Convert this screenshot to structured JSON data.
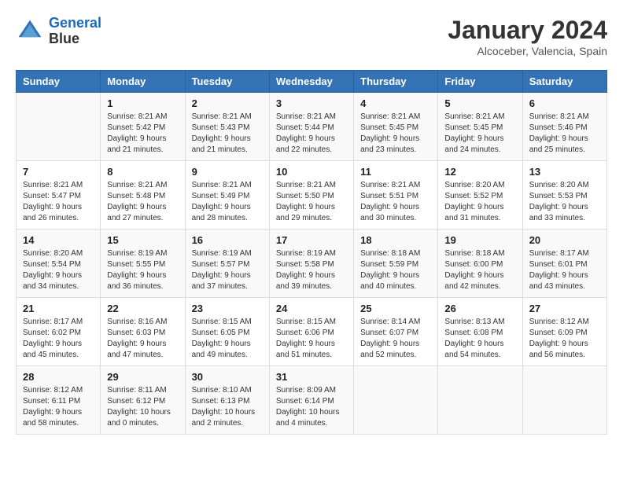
{
  "header": {
    "logo_line1": "General",
    "logo_line2": "Blue",
    "title": "January 2024",
    "subtitle": "Alcoceber, Valencia, Spain"
  },
  "days_of_week": [
    "Sunday",
    "Monday",
    "Tuesday",
    "Wednesday",
    "Thursday",
    "Friday",
    "Saturday"
  ],
  "weeks": [
    [
      {
        "day": "",
        "info": ""
      },
      {
        "day": "1",
        "info": "Sunrise: 8:21 AM\nSunset: 5:42 PM\nDaylight: 9 hours\nand 21 minutes."
      },
      {
        "day": "2",
        "info": "Sunrise: 8:21 AM\nSunset: 5:43 PM\nDaylight: 9 hours\nand 21 minutes."
      },
      {
        "day": "3",
        "info": "Sunrise: 8:21 AM\nSunset: 5:44 PM\nDaylight: 9 hours\nand 22 minutes."
      },
      {
        "day": "4",
        "info": "Sunrise: 8:21 AM\nSunset: 5:45 PM\nDaylight: 9 hours\nand 23 minutes."
      },
      {
        "day": "5",
        "info": "Sunrise: 8:21 AM\nSunset: 5:45 PM\nDaylight: 9 hours\nand 24 minutes."
      },
      {
        "day": "6",
        "info": "Sunrise: 8:21 AM\nSunset: 5:46 PM\nDaylight: 9 hours\nand 25 minutes."
      }
    ],
    [
      {
        "day": "7",
        "info": "Sunrise: 8:21 AM\nSunset: 5:47 PM\nDaylight: 9 hours\nand 26 minutes."
      },
      {
        "day": "8",
        "info": "Sunrise: 8:21 AM\nSunset: 5:48 PM\nDaylight: 9 hours\nand 27 minutes."
      },
      {
        "day": "9",
        "info": "Sunrise: 8:21 AM\nSunset: 5:49 PM\nDaylight: 9 hours\nand 28 minutes."
      },
      {
        "day": "10",
        "info": "Sunrise: 8:21 AM\nSunset: 5:50 PM\nDaylight: 9 hours\nand 29 minutes."
      },
      {
        "day": "11",
        "info": "Sunrise: 8:21 AM\nSunset: 5:51 PM\nDaylight: 9 hours\nand 30 minutes."
      },
      {
        "day": "12",
        "info": "Sunrise: 8:20 AM\nSunset: 5:52 PM\nDaylight: 9 hours\nand 31 minutes."
      },
      {
        "day": "13",
        "info": "Sunrise: 8:20 AM\nSunset: 5:53 PM\nDaylight: 9 hours\nand 33 minutes."
      }
    ],
    [
      {
        "day": "14",
        "info": "Sunrise: 8:20 AM\nSunset: 5:54 PM\nDaylight: 9 hours\nand 34 minutes."
      },
      {
        "day": "15",
        "info": "Sunrise: 8:19 AM\nSunset: 5:55 PM\nDaylight: 9 hours\nand 36 minutes."
      },
      {
        "day": "16",
        "info": "Sunrise: 8:19 AM\nSunset: 5:57 PM\nDaylight: 9 hours\nand 37 minutes."
      },
      {
        "day": "17",
        "info": "Sunrise: 8:19 AM\nSunset: 5:58 PM\nDaylight: 9 hours\nand 39 minutes."
      },
      {
        "day": "18",
        "info": "Sunrise: 8:18 AM\nSunset: 5:59 PM\nDaylight: 9 hours\nand 40 minutes."
      },
      {
        "day": "19",
        "info": "Sunrise: 8:18 AM\nSunset: 6:00 PM\nDaylight: 9 hours\nand 42 minutes."
      },
      {
        "day": "20",
        "info": "Sunrise: 8:17 AM\nSunset: 6:01 PM\nDaylight: 9 hours\nand 43 minutes."
      }
    ],
    [
      {
        "day": "21",
        "info": "Sunrise: 8:17 AM\nSunset: 6:02 PM\nDaylight: 9 hours\nand 45 minutes."
      },
      {
        "day": "22",
        "info": "Sunrise: 8:16 AM\nSunset: 6:03 PM\nDaylight: 9 hours\nand 47 minutes."
      },
      {
        "day": "23",
        "info": "Sunrise: 8:15 AM\nSunset: 6:05 PM\nDaylight: 9 hours\nand 49 minutes."
      },
      {
        "day": "24",
        "info": "Sunrise: 8:15 AM\nSunset: 6:06 PM\nDaylight: 9 hours\nand 51 minutes."
      },
      {
        "day": "25",
        "info": "Sunrise: 8:14 AM\nSunset: 6:07 PM\nDaylight: 9 hours\nand 52 minutes."
      },
      {
        "day": "26",
        "info": "Sunrise: 8:13 AM\nSunset: 6:08 PM\nDaylight: 9 hours\nand 54 minutes."
      },
      {
        "day": "27",
        "info": "Sunrise: 8:12 AM\nSunset: 6:09 PM\nDaylight: 9 hours\nand 56 minutes."
      }
    ],
    [
      {
        "day": "28",
        "info": "Sunrise: 8:12 AM\nSunset: 6:11 PM\nDaylight: 9 hours\nand 58 minutes."
      },
      {
        "day": "29",
        "info": "Sunrise: 8:11 AM\nSunset: 6:12 PM\nDaylight: 10 hours\nand 0 minutes."
      },
      {
        "day": "30",
        "info": "Sunrise: 8:10 AM\nSunset: 6:13 PM\nDaylight: 10 hours\nand 2 minutes."
      },
      {
        "day": "31",
        "info": "Sunrise: 8:09 AM\nSunset: 6:14 PM\nDaylight: 10 hours\nand 4 minutes."
      },
      {
        "day": "",
        "info": ""
      },
      {
        "day": "",
        "info": ""
      },
      {
        "day": "",
        "info": ""
      }
    ]
  ]
}
